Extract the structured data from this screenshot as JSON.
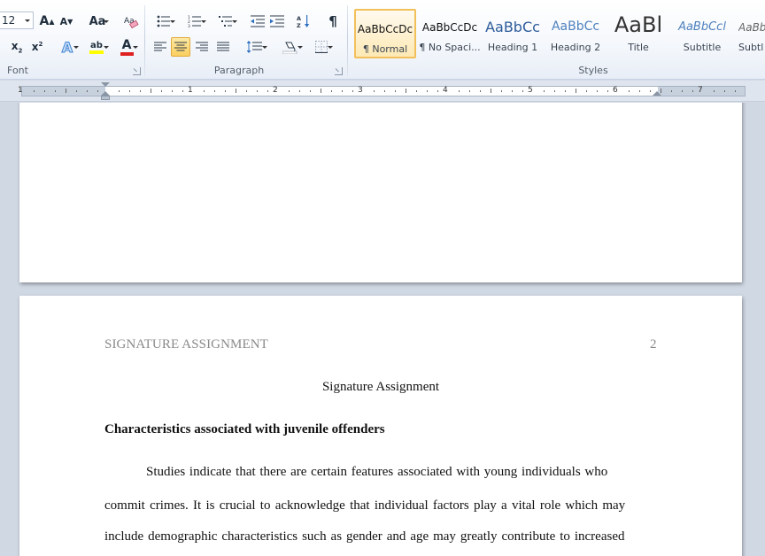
{
  "ribbon": {
    "font_group": {
      "label": "Font",
      "font_size": "12",
      "grow_font": "A",
      "shrink_font": "A",
      "change_case": "Aa",
      "subscript": "x",
      "subscript_mark": "2",
      "superscript": "x",
      "superscript_mark": "2",
      "text_effects": "A",
      "highlight": "ab",
      "font_color": "A"
    },
    "paragraph_group": {
      "label": "Paragraph",
      "pilcrow": "¶"
    },
    "styles_group": {
      "label": "Styles",
      "styles": [
        {
          "preview": "AaBbCcDc",
          "name": "¶ Normal"
        },
        {
          "preview": "AaBbCcDc",
          "name": "¶ No Spaci..."
        },
        {
          "preview": "AaBbCc",
          "name": "Heading 1"
        },
        {
          "preview": "AaBbCc",
          "name": "Heading 2"
        },
        {
          "preview": "AaBl",
          "name": "Title"
        },
        {
          "preview": "AaBbCcl",
          "name": "Subtitle"
        },
        {
          "preview": "AaBb",
          "name": "Subtl"
        }
      ]
    },
    "colors": {
      "highlight_bar": "#ffff00",
      "font_color_bar": "#e02020",
      "active_border": "#f2c05b"
    }
  },
  "ruler": {
    "numbers": [
      "1",
      "1",
      "2",
      "3",
      "4",
      "5",
      "6",
      "7"
    ]
  },
  "document": {
    "running_head": "SIGNATURE ASSIGNMENT",
    "page_number": "2",
    "title": "Signature Assignment",
    "heading": "Characteristics associated with juvenile offenders",
    "paragraph_lines": [
      "Studies indicate that there are certain features associated with young individuals who",
      "commit crimes.  It is crucial to acknowledge that individual factors play a vital role which may",
      "include demographic characteristics such as gender and age may greatly contribute to increased"
    ]
  }
}
